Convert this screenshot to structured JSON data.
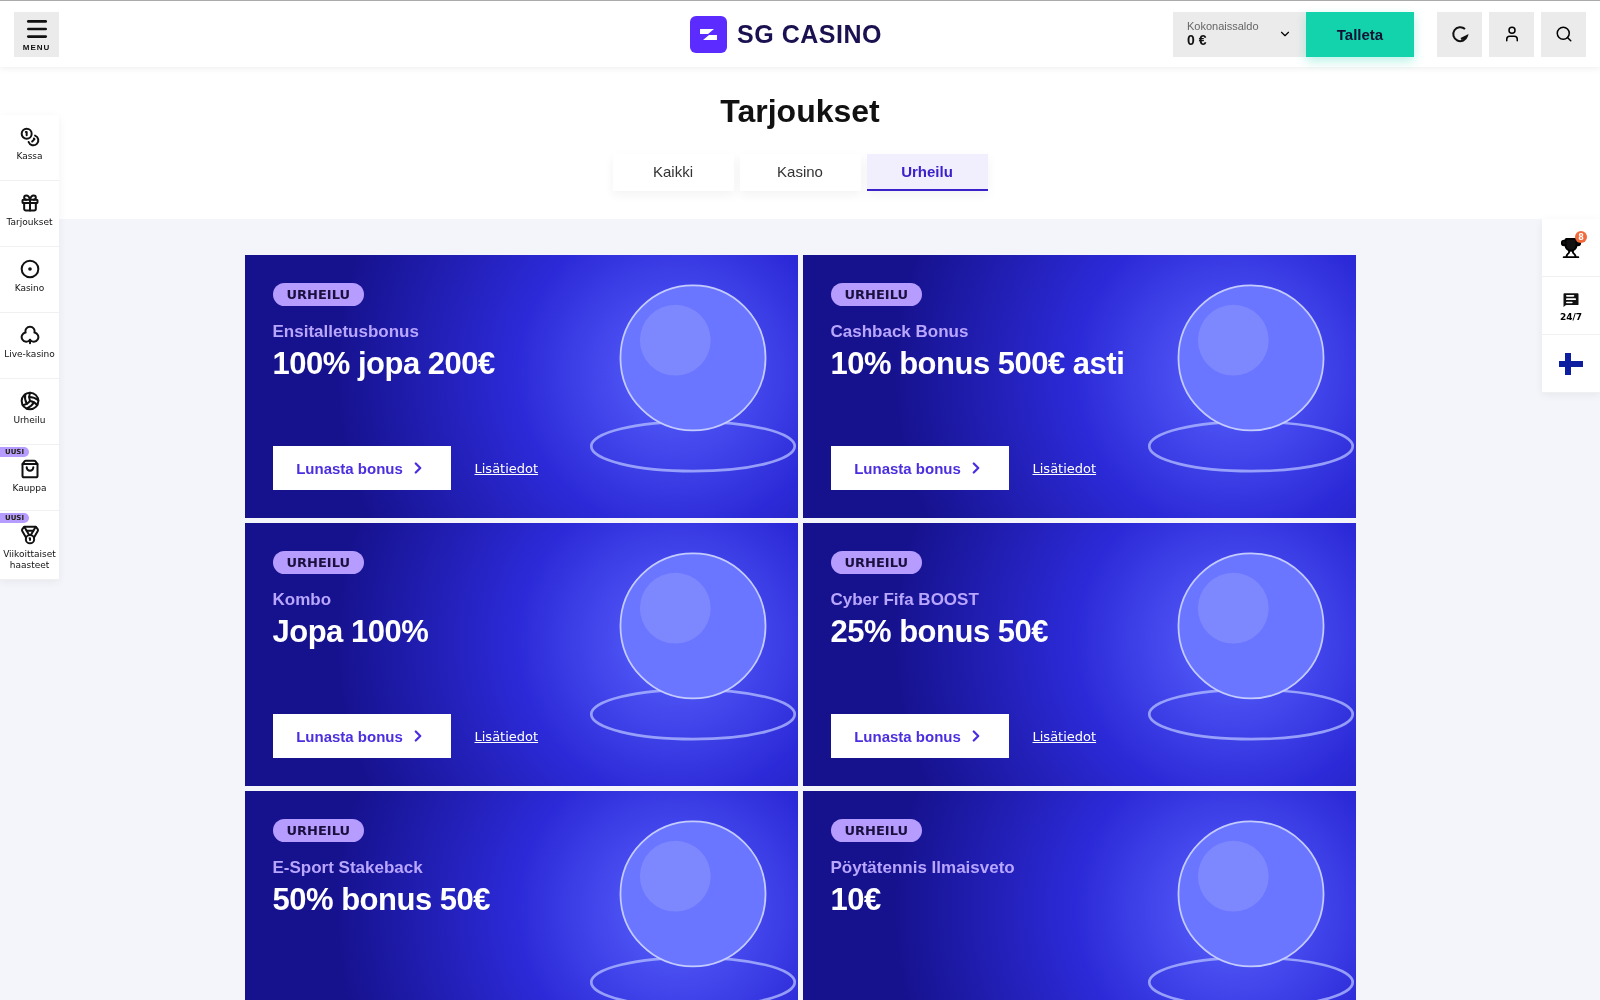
{
  "header": {
    "menu_label": "MENU",
    "logo_text": "SG CASINO",
    "balance": {
      "label": "Kokonaissaldo",
      "value": "0 €"
    },
    "deposit_button": "Talleta"
  },
  "sidebar": {
    "items": [
      {
        "label": "Kassa"
      },
      {
        "label": "Tarjoukset"
      },
      {
        "label": "Kasino"
      },
      {
        "label": "Live-kasino"
      },
      {
        "label": "Urheilu"
      },
      {
        "label": "Kauppa",
        "badge": "UUSI"
      },
      {
        "label": "Viikoittaiset haasteet",
        "badge": "UUSI"
      }
    ]
  },
  "right_rail": {
    "trophy_count": "8",
    "chat_label": "24/7"
  },
  "page": {
    "title": "Tarjoukset"
  },
  "tabs": [
    {
      "label": "Kaikki",
      "selected": false
    },
    {
      "label": "Kasino",
      "selected": false
    },
    {
      "label": "Urheilu",
      "selected": true
    }
  ],
  "offers": [
    {
      "tag": "URHEILU",
      "name": "Ensitalletusbonus",
      "headline": "100% jopa 200€",
      "cta": "Lunasta bonus",
      "more": "Lisätiedot"
    },
    {
      "tag": "URHEILU",
      "name": "Cashback Bonus",
      "headline": "10% bonus 500€ asti",
      "cta": "Lunasta bonus",
      "more": "Lisätiedot"
    },
    {
      "tag": "URHEILU",
      "name": "Kombo",
      "headline": "Jopa 100%",
      "cta": "Lunasta bonus",
      "more": "Lisätiedot"
    },
    {
      "tag": "URHEILU",
      "name": "Cyber Fifa BOOST",
      "headline": "25% bonus 50€",
      "cta": "Lunasta bonus",
      "more": "Lisätiedot"
    },
    {
      "tag": "URHEILU",
      "name": "E-Sport Stakeback",
      "headline": "50% bonus 50€"
    },
    {
      "tag": "URHEILU",
      "name": "Pöytätennis Ilmaisveto",
      "headline": "10€"
    }
  ]
}
